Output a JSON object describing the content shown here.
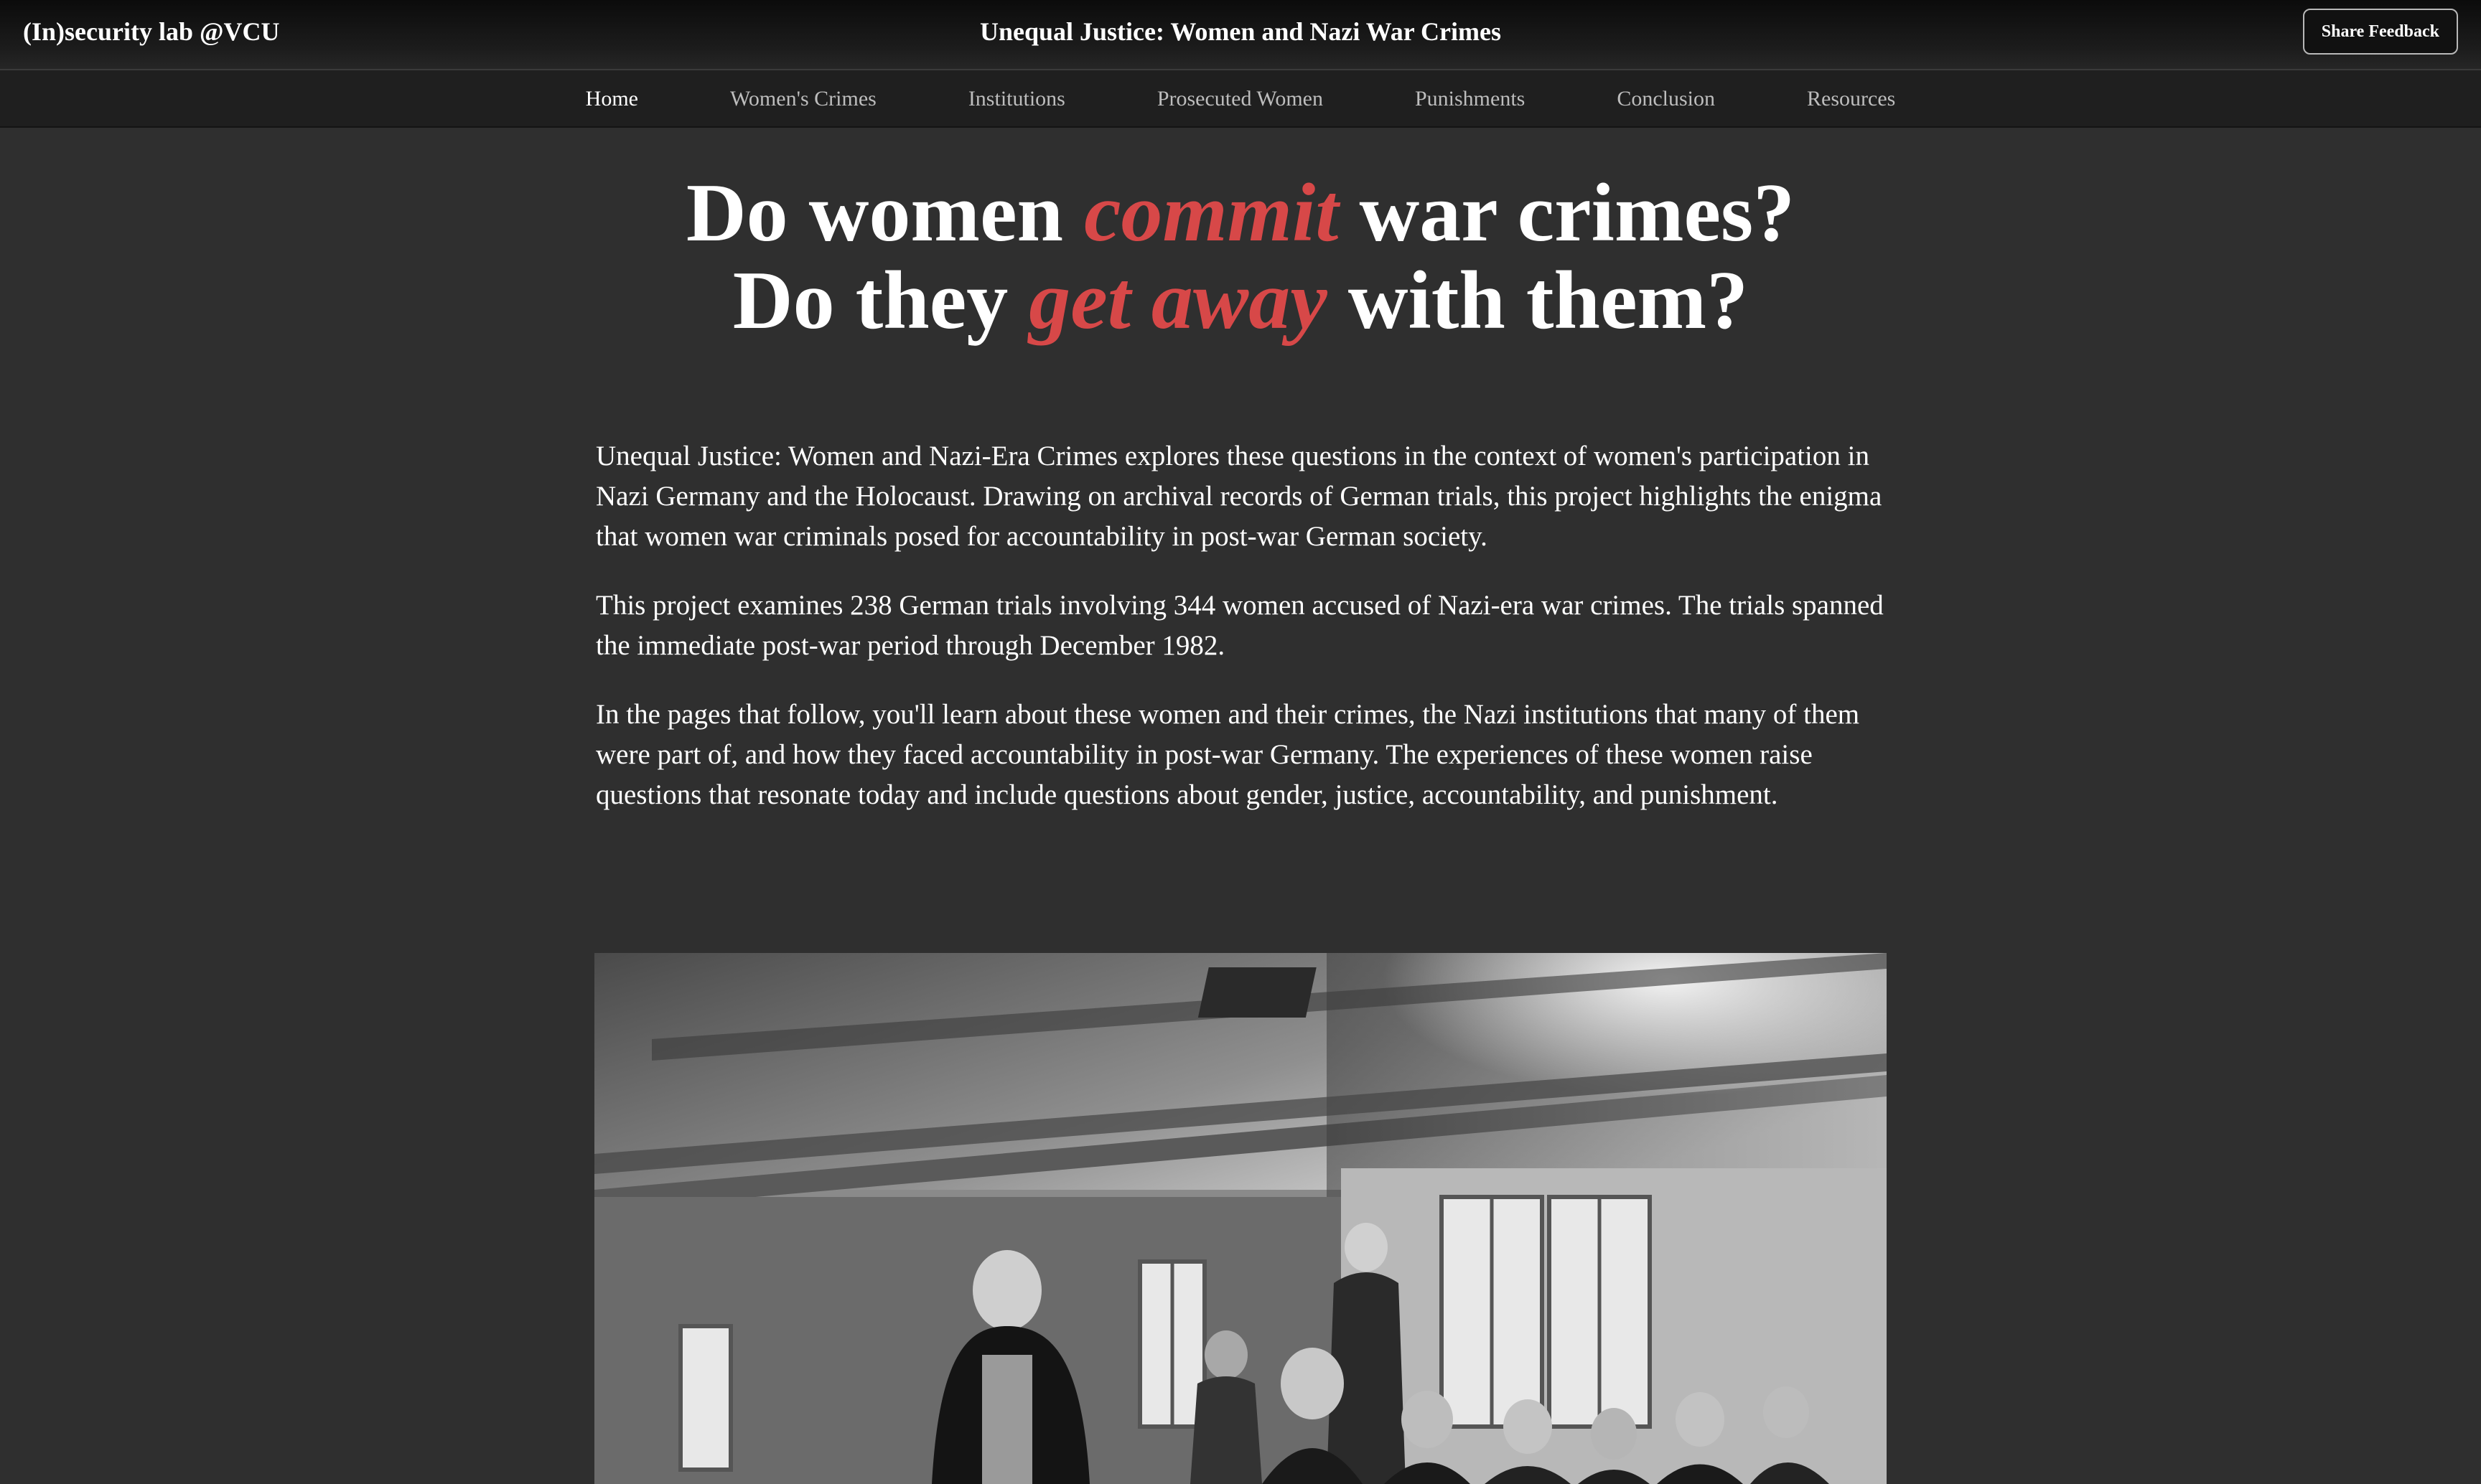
{
  "header": {
    "brand": "(In)security lab @VCU",
    "site_title": "Unequal Justice: Women and Nazi War Crimes",
    "feedback_label": "Share Feedback"
  },
  "nav": {
    "items": [
      {
        "label": "Home",
        "active": true
      },
      {
        "label": "Women's Crimes",
        "active": false
      },
      {
        "label": "Institutions",
        "active": false
      },
      {
        "label": "Prosecuted Women",
        "active": false
      },
      {
        "label": "Punishments",
        "active": false
      },
      {
        "label": "Conclusion",
        "active": false
      },
      {
        "label": "Resources",
        "active": false
      }
    ]
  },
  "hero": {
    "line1_pre": "Do women ",
    "line1_accent": "commit",
    "line1_post": " war crimes?",
    "line2_pre": "Do they ",
    "line2_accent": "get away",
    "line2_post": " with them?"
  },
  "intro": {
    "paragraphs": [
      "Unequal Justice: Women and Nazi-Era Crimes explores these questions in the context of women's participation in Nazi Germany and the Holocaust. Drawing on archival records of German trials, this project highlights the enigma that women war criminals posed for accountability in post-war German society.",
      "This project examines 238 German trials involving 344 women accused of Nazi-era war crimes. The trials spanned the immediate post-war period through December 1982.",
      "In the pages that follow, you'll learn about these women and their crimes, the Nazi institutions that many of them were part of, and how they faced accountability in post-war Germany. The experiences of these women raise questions that resonate today and include questions about gender, justice, accountability, and punishment."
    ]
  },
  "colors": {
    "accent": "#d74848",
    "background": "#2f2f2f",
    "header": "#141414",
    "nav": "#1f1f1f"
  },
  "photo": {
    "kind": "black-and-white courtroom photograph"
  }
}
